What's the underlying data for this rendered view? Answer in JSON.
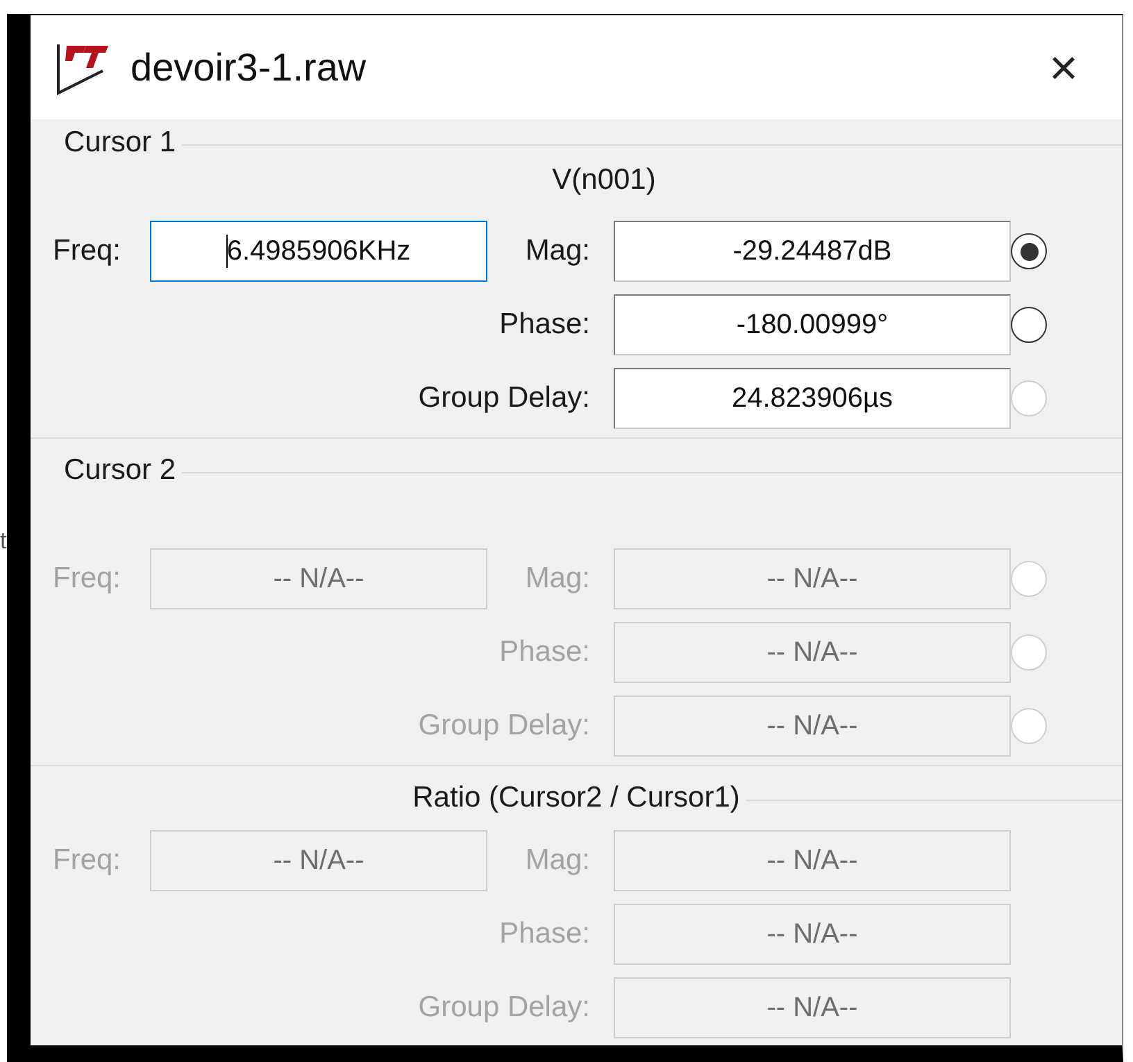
{
  "edge_text": "t",
  "window": {
    "title": "devoir3-1.raw",
    "close": "×"
  },
  "groups": [
    {
      "kind": "cursor",
      "title": "Cursor 1",
      "signal": "V(n001)",
      "freq": {
        "label": "Freq:",
        "value": "6.4985906KHz",
        "disabled": false,
        "focused": true
      },
      "measures": [
        {
          "label": "Mag:",
          "value": "-29.24487dB",
          "disabled": false,
          "selected": true,
          "radio_disabled": false
        },
        {
          "label": "Phase:",
          "value": "-180.00999°",
          "disabled": false,
          "selected": false,
          "radio_disabled": false
        },
        {
          "label": "Group Delay:",
          "value": "24.823906µs",
          "disabled": false,
          "selected": false,
          "radio_disabled": true
        }
      ]
    },
    {
      "kind": "cursor",
      "title": "Cursor 2",
      "freq": {
        "label": "Freq:",
        "value": "-- N/A--",
        "disabled": true,
        "focused": false
      },
      "measures": [
        {
          "label": "Mag:",
          "value": "-- N/A--",
          "disabled": true,
          "selected": false,
          "radio_disabled": true
        },
        {
          "label": "Phase:",
          "value": "-- N/A--",
          "disabled": true,
          "selected": false,
          "radio_disabled": true
        },
        {
          "label": "Group Delay:",
          "value": "-- N/A--",
          "disabled": true,
          "selected": false,
          "radio_disabled": true
        }
      ]
    },
    {
      "kind": "ratio",
      "title": "Ratio (Cursor2 / Cursor1)",
      "freq": {
        "label": "Freq:",
        "value": "-- N/A--",
        "disabled": true,
        "focused": false
      },
      "measures": [
        {
          "label": "Mag:",
          "value": "-- N/A--",
          "disabled": true
        },
        {
          "label": "Phase:",
          "value": "-- N/A--",
          "disabled": true
        },
        {
          "label": "Group Delay:",
          "value": "-- N/A--",
          "disabled": true
        }
      ]
    }
  ]
}
